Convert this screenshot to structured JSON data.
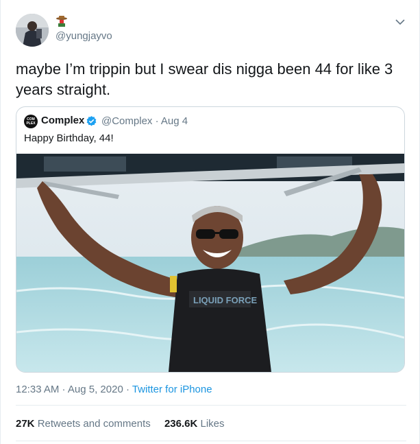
{
  "tweet": {
    "handle": "@yungjayvo",
    "text": "maybe I’m trippin but I swear dis nigga been 44 for like 3 years straight.",
    "timestamp": "12:33 AM · Aug 5, 2020 · ",
    "source": "Twitter for iPhone"
  },
  "quoted_tweet": {
    "avatar_text": "COM PLEX",
    "name": "Complex",
    "handle_date": "@Complex · Aug 4",
    "text": "Happy Birthday, 44!",
    "photo_vest_text": "LIQUID FORCE"
  },
  "stats": {
    "retweets_count": "27K",
    "retweets_label": "Retweets and comments",
    "likes_count": "236.6K",
    "likes_label": "Likes"
  },
  "colors": {
    "link": "#1b95e0",
    "verified": "#1da1f2",
    "secondary_text": "#657786"
  },
  "icons": {
    "caret": "chevron-down-icon",
    "verified": "verified-badge-icon",
    "name_emoji": "cowboy-emoji-icon"
  }
}
